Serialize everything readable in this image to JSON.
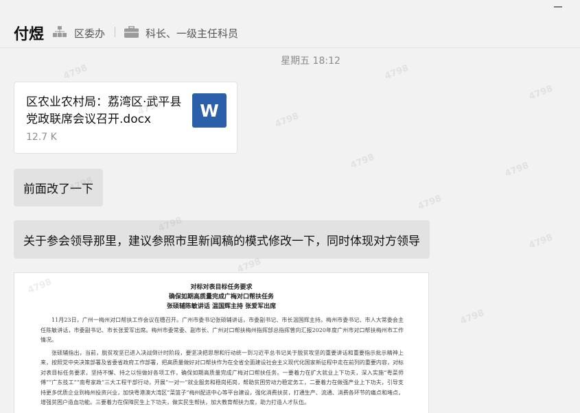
{
  "window": {
    "minimize_label": ""
  },
  "header": {
    "contact_name": "付煜",
    "org": "区委办",
    "title": "科长、一级主任科员"
  },
  "timestamp": "星期五 18:12",
  "file_message": {
    "file_name": "区农业农村局：荔湾区·武平县党政联席会议召开.docx",
    "file_size": "12.7 K",
    "icon_letter": "W",
    "icon_color": "#2b5faa"
  },
  "messages": [
    {
      "text": "前面改了一下"
    },
    {
      "text": "关于参会领导那里，建议参照市里新闻稿的模式修改一下，同时体现对方领导"
    }
  ],
  "document_image": {
    "title_1": "对标对表目标任务要求",
    "title_2": "确保如期高质量完成广梅对口帮扶任务",
    "title_3": "张硕辅陈敏讲话 温国辉主持 张爱军出席",
    "para_1": "11月23日，广州一梅州对口帮扶工作会议在穗召开。广州市委书记张硕辅讲话，市委副书记、市长温国辉主持。梅州市委书记、市人大常委会主任陈敏讲话，市委副书记、市长张爱军出席。梅州市委常委、副市长、广州对口帮扶梅州指挥部总指挥曾向汇报2020年度广州市对口帮扶梅州市工作情况。",
    "para_2": "张硕辅指出，当前，脱贫攻坚已进入决战倒计时阶段，要坚决把思想和行动统一到习近平总书记关于脱贫攻坚的重要讲话和重要指示批示精神上来，按照党中央决策部署及省委省政府工作部署，把高质量做好对口帮扶作为在全省全面建设社会主义现代化国家新征程中走在前列的重要内容，对标对表目标任务要求，坚持不懈、持之以恒做好各项工作，确保如期高质量完成广梅对口帮扶任务。一要着力在扩大就业上下功夫，深入实施“粤菜师傅”“广东技工”“南粤家政”三大工程干部行动，开展“一对一”就业服务和稳岗拓岗，帮助贫困劳动力稳定务工，二要着力在做强产业上下功夫，引导支持更多优质企业到梅州投资兴业，加快粤港澳大湾区“菜篮子”梅州配送中心等平台建设，强化消费扶贫，打通生产、流通、消费各环节的痛点和堵点，增强贫困户造血功能。三要着力在保障民生上下功夫，做实民生帮扶，加大教育帮扶力度，助力打造人才队伍。"
  },
  "watermark": "4798"
}
